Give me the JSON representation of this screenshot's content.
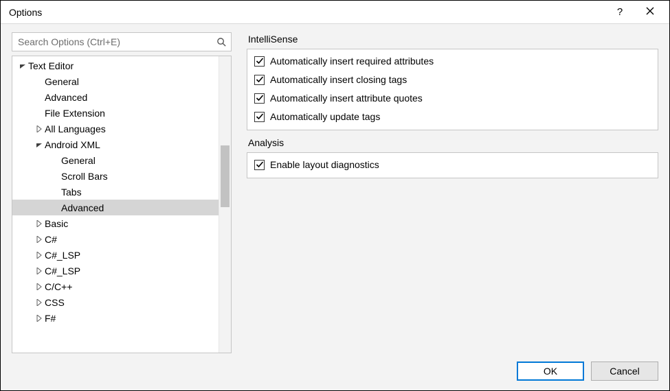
{
  "window": {
    "title": "Options",
    "help": "?",
    "close": "✕"
  },
  "search": {
    "placeholder": "Search Options (Ctrl+E)"
  },
  "tree": [
    {
      "label": "Text Editor",
      "depth": 0,
      "expander": "expanded",
      "selected": false
    },
    {
      "label": "General",
      "depth": 1,
      "expander": "none",
      "selected": false
    },
    {
      "label": "Advanced",
      "depth": 1,
      "expander": "none",
      "selected": false
    },
    {
      "label": "File Extension",
      "depth": 1,
      "expander": "none",
      "selected": false
    },
    {
      "label": "All Languages",
      "depth": 1,
      "expander": "collapsed",
      "selected": false
    },
    {
      "label": "Android XML",
      "depth": 1,
      "expander": "expanded",
      "selected": false
    },
    {
      "label": "General",
      "depth": 2,
      "expander": "none",
      "selected": false
    },
    {
      "label": "Scroll Bars",
      "depth": 2,
      "expander": "none",
      "selected": false
    },
    {
      "label": "Tabs",
      "depth": 2,
      "expander": "none",
      "selected": false
    },
    {
      "label": "Advanced",
      "depth": 2,
      "expander": "none",
      "selected": true
    },
    {
      "label": "Basic",
      "depth": 1,
      "expander": "collapsed",
      "selected": false
    },
    {
      "label": "C#",
      "depth": 1,
      "expander": "collapsed",
      "selected": false
    },
    {
      "label": "C#_LSP",
      "depth": 1,
      "expander": "collapsed",
      "selected": false
    },
    {
      "label": "C#_LSP",
      "depth": 1,
      "expander": "collapsed",
      "selected": false
    },
    {
      "label": "C/C++",
      "depth": 1,
      "expander": "collapsed",
      "selected": false
    },
    {
      "label": "CSS",
      "depth": 1,
      "expander": "collapsed",
      "selected": false
    },
    {
      "label": "F#",
      "depth": 1,
      "expander": "collapsed",
      "selected": false
    }
  ],
  "groups": {
    "intellisense": {
      "title": "IntelliSense",
      "items": [
        "Automatically insert required attributes",
        "Automatically insert closing tags",
        "Automatically insert attribute quotes",
        "Automatically update tags"
      ]
    },
    "analysis": {
      "title": "Analysis",
      "items": [
        "Enable layout diagnostics"
      ]
    }
  },
  "buttons": {
    "ok": "OK",
    "cancel": "Cancel"
  }
}
